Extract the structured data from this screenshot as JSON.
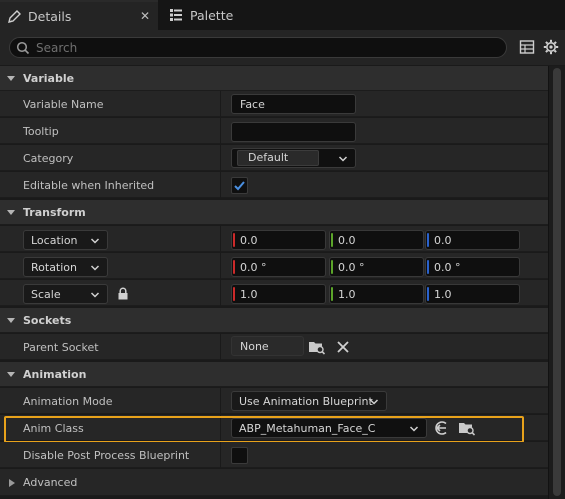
{
  "tabs": [
    {
      "label": "Details",
      "icon": "pencil-icon",
      "active": true
    },
    {
      "label": "Palette",
      "icon": "palette-icon",
      "active": false
    }
  ],
  "search": {
    "placeholder": "Search"
  },
  "toolbar_icons": [
    "table-view-icon",
    "settings-gear-icon"
  ],
  "sections": {
    "variable": "Variable",
    "transform": "Transform",
    "sockets": "Sockets",
    "animation": "Animation",
    "advanced": "Advanced"
  },
  "variable": {
    "name_label": "Variable Name",
    "name_value": "Face",
    "tooltip_label": "Tooltip",
    "tooltip_value": "",
    "category_label": "Category",
    "category_value": "Default",
    "editable_label": "Editable when Inherited",
    "editable_checked": true
  },
  "transform": {
    "location": {
      "mode": "Location",
      "values": [
        "0.0",
        "0.0",
        "0.0"
      ]
    },
    "rotation": {
      "mode": "Rotation",
      "values": [
        "0.0 °",
        "0.0 °",
        "0.0 °"
      ]
    },
    "scale": {
      "mode": "Scale",
      "values": [
        "1.0",
        "1.0",
        "1.0"
      ],
      "locked": true
    }
  },
  "sockets": {
    "parent_label": "Parent Socket",
    "parent_value": "None"
  },
  "animation": {
    "mode_label": "Animation Mode",
    "mode_value": "Use Animation Blueprint",
    "class_label": "Anim Class",
    "class_value": "ABP_Metahuman_Face_C",
    "disable_label": "Disable Post Process Blueprint",
    "disable_checked": false
  },
  "colors": {
    "highlight": "#e8a21b",
    "x_axis": "#cc2a2a",
    "y_axis": "#5ca52a",
    "z_axis": "#2a62cc",
    "check": "#4a8fe0"
  }
}
